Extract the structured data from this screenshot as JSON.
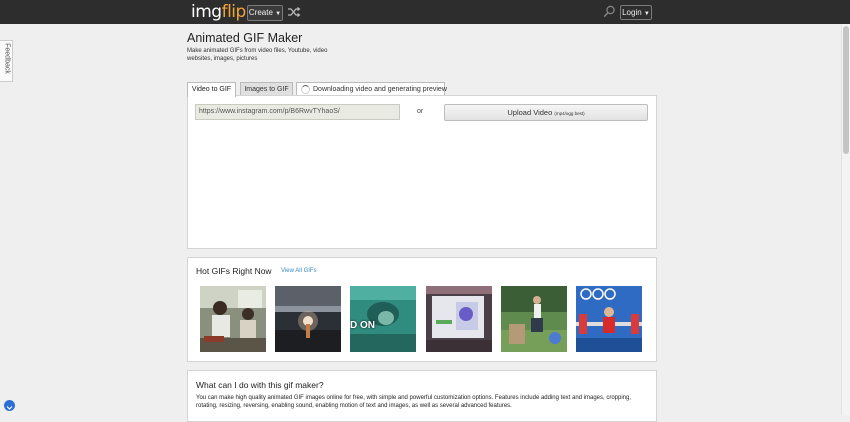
{
  "header": {
    "logo_part1": "img",
    "logo_part2": "flip",
    "create_label": "Create",
    "login_label": "Login",
    "colors": {
      "bar": "#2d2d2d",
      "logo_accent": "#f2a43a"
    }
  },
  "feedback_label": "Feedback",
  "page": {
    "title": "Animated GIF Maker",
    "subtitle": "Make animated GIFs from video files, Youtube, video websites, images, pictures"
  },
  "tabs": [
    {
      "label": "Video to GIF",
      "active": true
    },
    {
      "label": "Images to GIF",
      "active": false
    },
    {
      "label": "Downloading video and generating preview",
      "active": false
    }
  ],
  "maker": {
    "url_value": "https://www.instagram.com/p/B6RwvTYhaoS/",
    "or_label": "or",
    "upload_label": "Upload Video",
    "upload_hint": "(mp4/ogg best)"
  },
  "hot_gifs": {
    "title": "Hot GIFs Right Now",
    "view_all": "View All GIFs",
    "thumbnails": [
      {
        "name": "kids-room-gif",
        "caption": ""
      },
      {
        "name": "night-light-gif",
        "caption": ""
      },
      {
        "name": "underwater-creature-gif",
        "caption": "D ON"
      },
      {
        "name": "tablet-screen-gif",
        "caption": ""
      },
      {
        "name": "outdoor-jump-gif",
        "caption": ""
      },
      {
        "name": "weightlifter-gif",
        "caption": ""
      }
    ]
  },
  "faq": {
    "title": "What can I do with this gif maker?",
    "body": "You can make high quality animated GIF images online for free, with simple and powerful customization options. Features include adding text and images, cropping, rotating, resizing, reversing, enabling sound, enabling motion of text and images, as well as several advanced features."
  }
}
